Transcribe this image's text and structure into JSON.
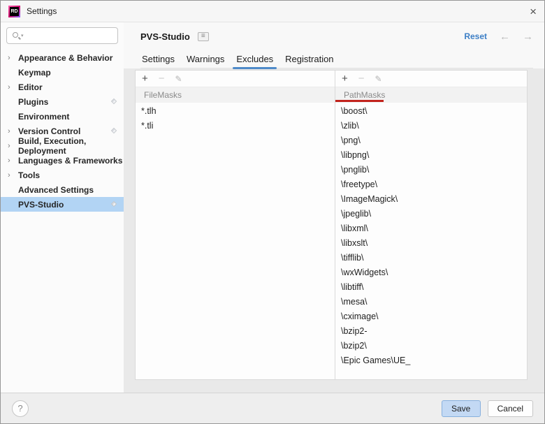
{
  "window": {
    "title": "Settings",
    "logo_text": "RD"
  },
  "icons": {
    "close": "×",
    "search_caret": "▾",
    "chevron": "›",
    "menu": "≡",
    "back_arrow": "←",
    "forward_arrow": "→",
    "add": "+",
    "remove": "−",
    "edit": "✎",
    "help": "?"
  },
  "sidebar": {
    "items": [
      {
        "label": "Appearance & Behavior",
        "chevron": true,
        "badge": false,
        "selected": false
      },
      {
        "label": "Keymap",
        "chevron": false,
        "badge": false,
        "selected": false
      },
      {
        "label": "Editor",
        "chevron": true,
        "badge": false,
        "selected": false
      },
      {
        "label": "Plugins",
        "chevron": false,
        "badge": true,
        "selected": false
      },
      {
        "label": "Environment",
        "chevron": false,
        "badge": false,
        "selected": false
      },
      {
        "label": "Version Control",
        "chevron": true,
        "badge": true,
        "selected": false
      },
      {
        "label": "Build, Execution, Deployment",
        "chevron": true,
        "badge": false,
        "selected": false
      },
      {
        "label": "Languages & Frameworks",
        "chevron": true,
        "badge": false,
        "selected": false
      },
      {
        "label": "Tools",
        "chevron": true,
        "badge": false,
        "selected": false
      },
      {
        "label": "Advanced Settings",
        "chevron": false,
        "badge": false,
        "selected": false
      },
      {
        "label": "PVS-Studio",
        "chevron": false,
        "badge": true,
        "selected": true
      }
    ]
  },
  "main": {
    "title": "PVS-Studio",
    "reset_label": "Reset",
    "tabs": [
      {
        "label": "Settings",
        "active": false
      },
      {
        "label": "Warnings",
        "active": false
      },
      {
        "label": "Excludes",
        "active": true
      },
      {
        "label": "Registration",
        "active": false
      }
    ],
    "panels": [
      {
        "header": "FileMasks",
        "items": [
          "*.tlh",
          "*.tli"
        ]
      },
      {
        "header": "PathMasks",
        "items": [
          "\\boost\\",
          "\\zlib\\",
          "\\png\\",
          "\\libpng\\",
          "\\pnglib\\",
          "\\freetype\\",
          "\\ImageMagick\\",
          "\\jpeglib\\",
          "\\libxml\\",
          "\\libxslt\\",
          "\\tifflib\\",
          "\\wxWidgets\\",
          "\\libtiff\\",
          "\\mesa\\",
          "\\cximage\\",
          "\\bzip2-",
          "\\bzip2\\",
          "\\Epic Games\\UE_"
        ]
      }
    ]
  },
  "footer": {
    "save_label": "Save",
    "cancel_label": "Cancel"
  },
  "colors": {
    "accent_blue": "#3d7fc6",
    "tab_underline": "#4e8ac9",
    "sidebar_selection": "#b2d4f4",
    "annotation_red": "#c2231c",
    "save_button_bg": "#c3d9f4",
    "save_button_border": "#87b0dd"
  }
}
